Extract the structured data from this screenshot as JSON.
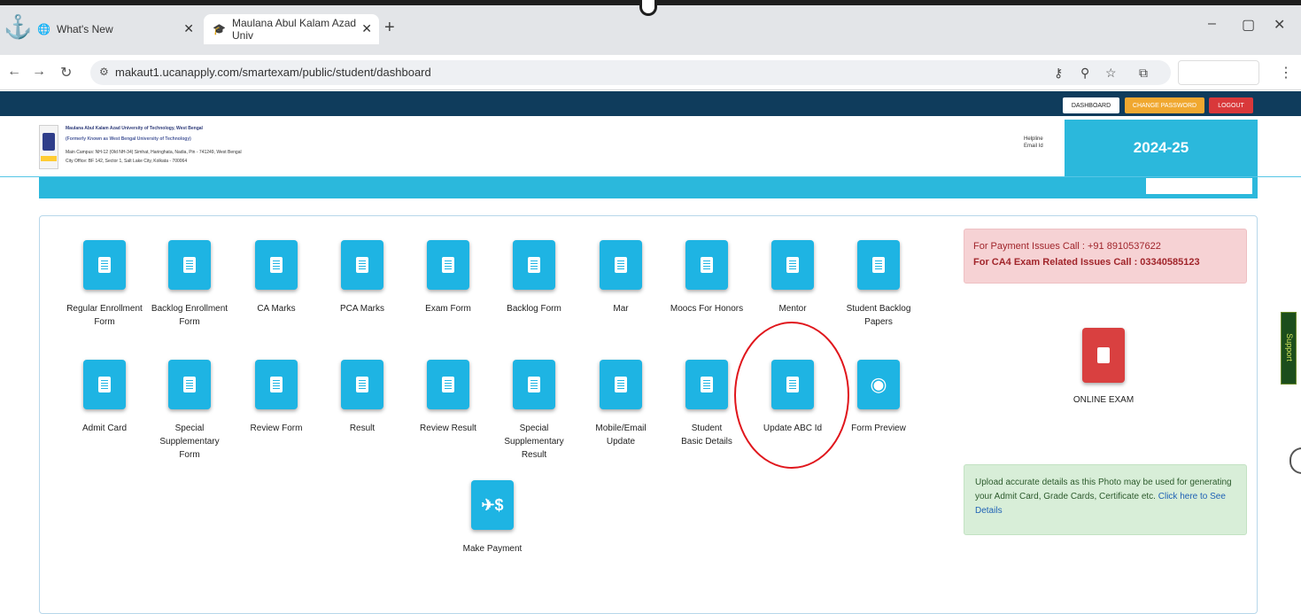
{
  "browser": {
    "tabs": [
      {
        "label": "What's New",
        "icon": "globe-icon"
      },
      {
        "label": "Maulana Abul Kalam Azad Univ",
        "icon": "university-icon"
      }
    ],
    "url": "makaut1.ucanapply.com/smartexam/public/student/dashboard"
  },
  "site": {
    "top_buttons": {
      "dashboard": "DASHBOARD",
      "change_password": "CHANGE PASSWORD",
      "logout": "LOGOUT"
    },
    "university_lines": [
      "Maulana Abul Kalam Azad University of Technology, West Bengal",
      "(Formerly Known as West Bengal University of Technology)",
      "Main Campus: NH-12 (Old NH-34) Simhat, Haringhata, Nadia, Pin - 741249, West Bengal",
      "City Office: BF 142, Sector 1, Salt Lake City, Kolkata - 700064"
    ],
    "helpline_label": "Helpline",
    "email_label": "Email Id",
    "session_year": "2024-25"
  },
  "menu": {
    "row1": [
      "Regular Enrollment Form",
      "Backlog Enrollment Form",
      "CA Marks",
      "PCA Marks",
      "Exam Form",
      "Backlog Form",
      "Mar",
      "Moocs For Honors",
      "Mentor",
      "Student Backlog Papers"
    ],
    "row2": [
      "Admit Card",
      "Special Supplementary Form",
      "Review Form",
      "Result",
      "Review Result",
      "Special Supplementary Result",
      "Mobile/Email Update",
      "Student Basic Details",
      "Update ABC Id",
      "Form Preview"
    ],
    "row3": [
      "Make Payment"
    ]
  },
  "sidebar": {
    "payment_issue": "For Payment Issues Call : +91 8910537622",
    "ca4_issue": "For CA4 Exam Related Issues Call : 03340585123",
    "online_exam": "ONLINE EXAM",
    "upload_notice": "Upload accurate details as this Photo may be used for generating your Admit Card, Grade Cards, Certificate etc.",
    "upload_link": "Click here to See Details",
    "support_tab": "Support"
  },
  "colors": {
    "navy": "#0f3c5c",
    "cyan": "#2bb8dc",
    "tile_blue": "#1eb4e3",
    "exam_red": "#d94040",
    "highlight_circle": "#e0161c"
  }
}
